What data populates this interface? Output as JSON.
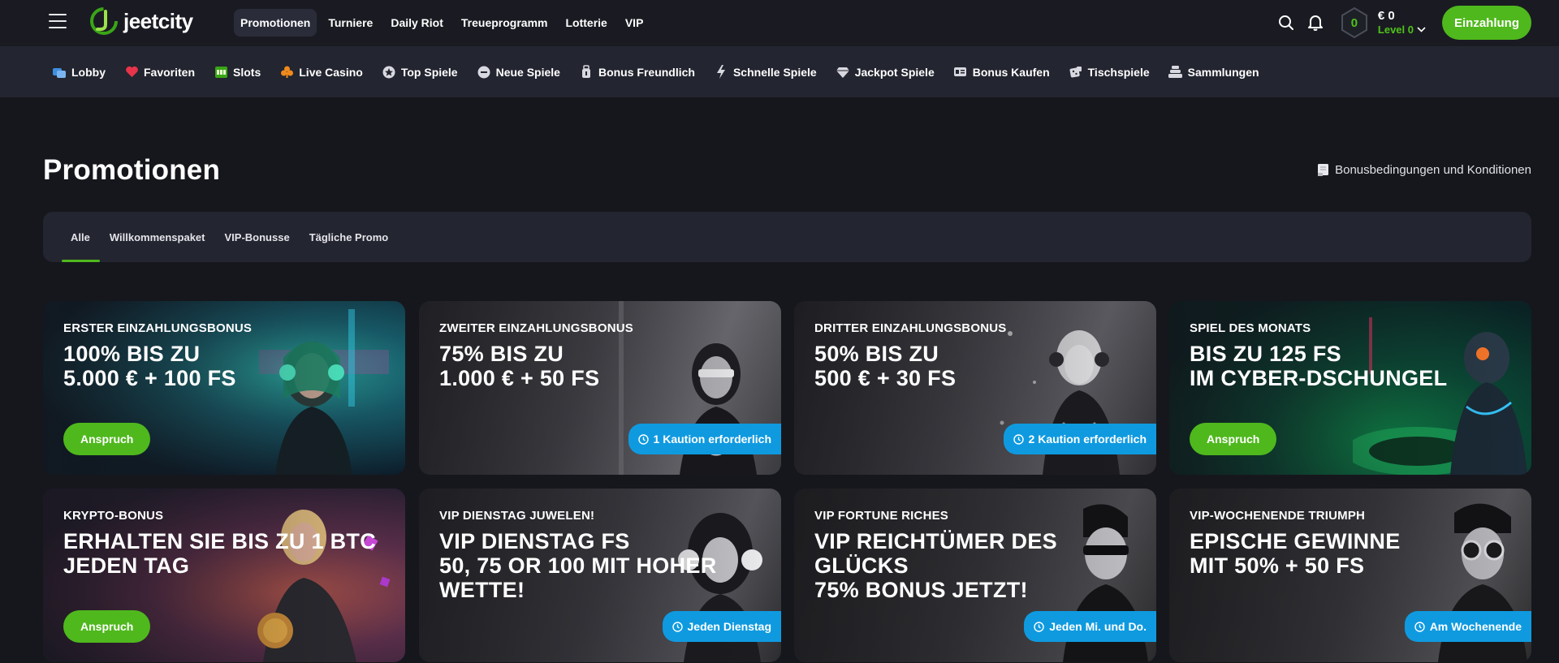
{
  "header": {
    "logo_text": "jeetcity",
    "nav": [
      {
        "label": "Promotionen",
        "active": true
      },
      {
        "label": "Turniere",
        "active": false
      },
      {
        "label": "Daily Riot",
        "active": false
      },
      {
        "label": "Treueprogramm",
        "active": false
      },
      {
        "label": "Lotterie",
        "active": false
      },
      {
        "label": "VIP",
        "active": false
      }
    ],
    "level_badge": "0",
    "balance": "€ 0",
    "level_label": "Level 0",
    "deposit_label": "Einzahlung"
  },
  "categories": [
    {
      "label": "Lobby",
      "icon": "lobby-icon"
    },
    {
      "label": "Favoriten",
      "icon": "heart-icon"
    },
    {
      "label": "Slots",
      "icon": "slots-icon"
    },
    {
      "label": "Live Casino",
      "icon": "club-icon"
    },
    {
      "label": "Top Spiele",
      "icon": "star-icon"
    },
    {
      "label": "Neue Spiele",
      "icon": "new-icon"
    },
    {
      "label": "Bonus Freundlich",
      "icon": "bonus-icon"
    },
    {
      "label": "Schnelle Spiele",
      "icon": "lightning-icon"
    },
    {
      "label": "Jackpot Spiele",
      "icon": "diamond-icon"
    },
    {
      "label": "Bonus Kaufen",
      "icon": "ticket-icon"
    },
    {
      "label": "Tischspiele",
      "icon": "dice-icon"
    },
    {
      "label": "Sammlungen",
      "icon": "stack-icon"
    }
  ],
  "page": {
    "title": "Promotionen",
    "terms_link": "Bonusbedingungen und Konditionen"
  },
  "tabs": [
    {
      "label": "Alle",
      "active": true
    },
    {
      "label": "Willkommenspaket",
      "active": false
    },
    {
      "label": "VIP-Bonusse",
      "active": false
    },
    {
      "label": "Tägliche Promo",
      "active": false
    }
  ],
  "promos": [
    {
      "eyebrow": "ERSTER EINZAHLUNGSBONUS",
      "headline": "100% BIS ZU\n5.000 € + 100 FS",
      "button": "Anspruch",
      "tag": ""
    },
    {
      "eyebrow": "ZWEITER EINZAHLUNGSBONUS",
      "headline": "75% BIS ZU\n1.000 € + 50 FS",
      "button": "",
      "tag": "1 Kaution erforderlich"
    },
    {
      "eyebrow": "DRITTER EINZAHLUNGSBONUS",
      "headline": "50% BIS ZU\n500 € + 30 FS",
      "button": "",
      "tag": "2 Kaution erforderlich"
    },
    {
      "eyebrow": "SPIEL DES MONATS",
      "headline": "BIS ZU 125 FS\nIM CYBER-DSCHUNGEL",
      "button": "Anspruch",
      "tag": ""
    },
    {
      "eyebrow": "KRYPTO-BONUS",
      "headline": "ERHALTEN SIE BIS ZU 1 BTC\nJEDEN TAG",
      "button": "Anspruch",
      "tag": ""
    },
    {
      "eyebrow": "VIP DIENSTAG JUWELEN!",
      "headline": "VIP DIENSTAG FS\n50, 75 OR 100 MIT HOHER\nWETTE!",
      "button": "",
      "tag": "Jeden Dienstag"
    },
    {
      "eyebrow": "VIP FORTUNE RICHES",
      "headline": "VIP REICHTÜMER DES GLÜCKS\n75% BONUS JETZT!",
      "button": "",
      "tag": "Jeden Mi. und Do."
    },
    {
      "eyebrow": "VIP-WOCHENENDE TRIUMPH",
      "headline": "EPISCHE GEWINNE\nMIT 50% + 50 FS",
      "button": "",
      "tag": "Am Wochenende"
    }
  ],
  "colors": {
    "accent_green": "#4fb81d",
    "tag_blue": "#0f9ae0",
    "background": "#16171d"
  }
}
